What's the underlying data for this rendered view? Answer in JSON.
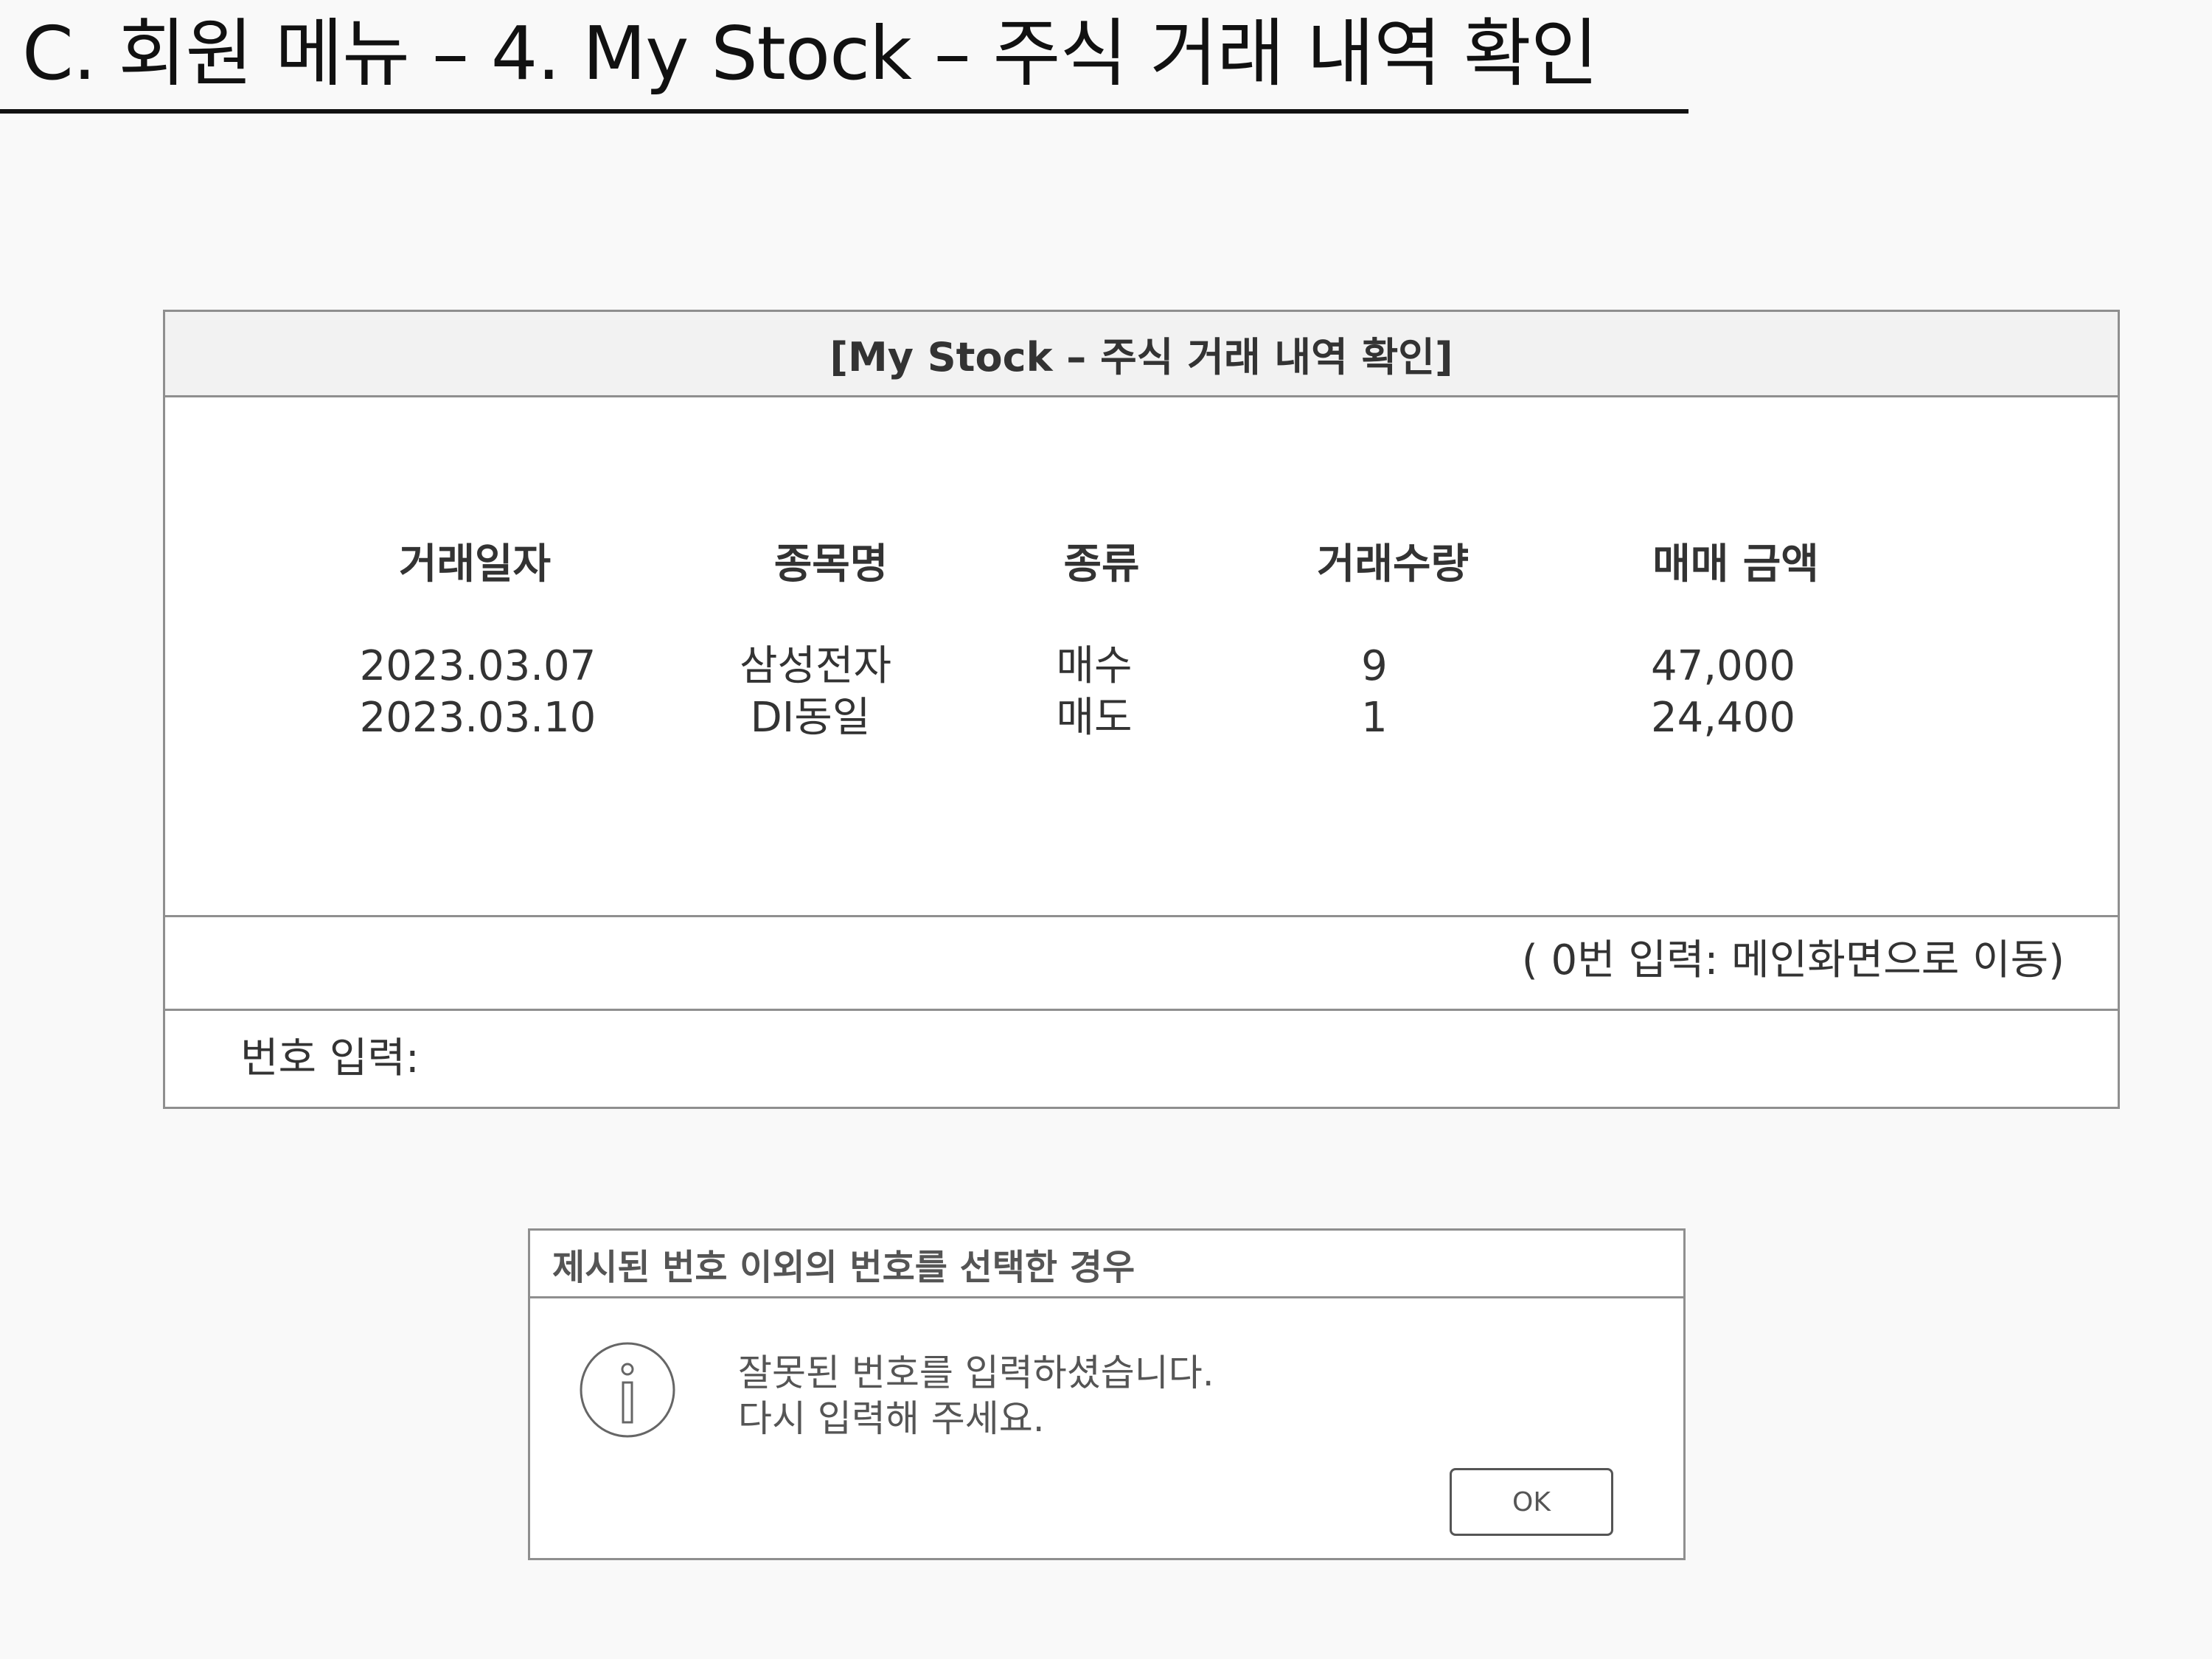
{
  "slide": {
    "title": "C. 회원 메뉴 – 4. My Stock – 주식 거래 내역 확인"
  },
  "window": {
    "header": "[My Stock – 주식 거래 내역 확인]",
    "columns": [
      "거래일자",
      "종목명",
      "종류",
      "거래수량",
      "매매 금액"
    ],
    "rows": [
      [
        "2023.03.07",
        "삼성전자",
        "매수",
        "9",
        "47,000"
      ],
      [
        "2023.03.10",
        "DI동일",
        "매도",
        "1",
        "24,400"
      ]
    ],
    "hint": "( 0번 입력: 메인화면으로 이동)",
    "input_label": "번호 입력:"
  },
  "dialog": {
    "title": "제시된 번호 이외의 번호를 선택한 경우",
    "icon": "info-icon",
    "message_line1": "잘못된 번호를 입력하셨습니다.",
    "message_line2": "다시 입력해 주세요.",
    "ok_label": "OK"
  }
}
